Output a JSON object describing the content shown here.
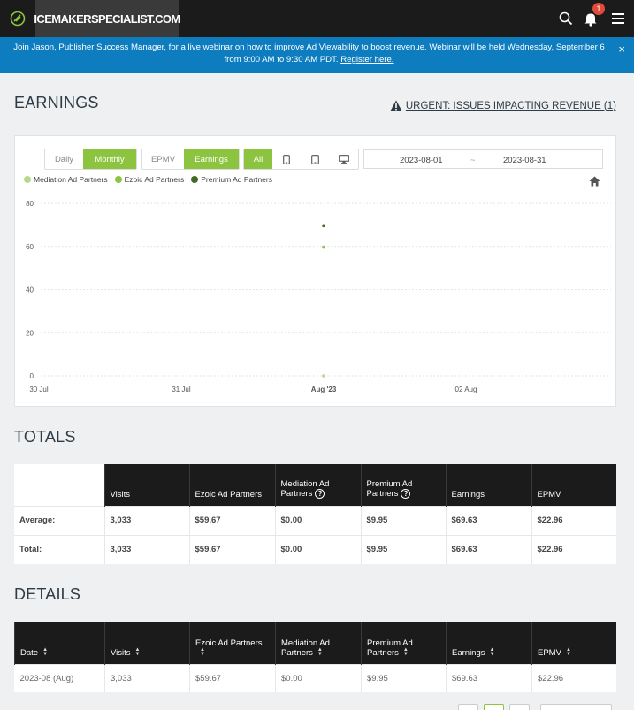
{
  "topbar": {
    "site_name": "ICEMAKERSPECIALIST.COM",
    "notification_count": "1",
    "icons": [
      "ezoic-logo-icon",
      "search-icon",
      "bell-icon",
      "menu-icon"
    ]
  },
  "banner": {
    "text": "Join Jason, Publisher Success Manager, for a live webinar on how to improve Ad Viewability to boost revenue. Webinar will be held Wednesday, September 6 from 9:00 AM to 9:30 AM PDT.",
    "link": "Register here.",
    "close": "×"
  },
  "earnings": {
    "title": "EARNINGS",
    "urgent_label": "URGENT: ISSUES IMPACTING REVENUE (1)"
  },
  "controls": {
    "period": [
      "Daily",
      "Monthly"
    ],
    "period_active": "Monthly",
    "metric": [
      "EPMV",
      "Earnings"
    ],
    "metric_active": "Earnings",
    "device_all": "All",
    "device_icons": [
      "tablet-icon",
      "mobile-icon",
      "desktop-icon"
    ],
    "date_start": "2023-08-01",
    "date_sep": "~",
    "date_end": "2023-08-31"
  },
  "chart_data": {
    "type": "scatter",
    "series": [
      {
        "name": "Mediation Ad Partners",
        "color": "#b5d88a",
        "points": [
          [
            "2023-08-01",
            0
          ]
        ]
      },
      {
        "name": "Ezoic Ad Partners",
        "color": "#8cc43f",
        "points": [
          [
            "2023-08-01",
            59.67
          ]
        ]
      },
      {
        "name": "Premium Ad Partners",
        "color": "#3f6b25",
        "points": [
          [
            "2023-08-01",
            69.63
          ]
        ]
      }
    ],
    "x_ticks": [
      "30 Jul",
      "31 Jul",
      "Aug '23",
      "02 Aug"
    ],
    "y_ticks": [
      0,
      20,
      40,
      60,
      80
    ],
    "ylim": [
      0,
      80
    ],
    "grid": true,
    "legend": "top-left"
  },
  "totals": {
    "title": "TOTALS",
    "headers": [
      "",
      "Visits",
      "Ezoic Ad Partners",
      "Mediation Ad Partners",
      "Premium Ad Partners",
      "Earnings",
      "EPMV"
    ],
    "rows": [
      [
        "Average:",
        "3,033",
        "$59.67",
        "$0.00",
        "$9.95",
        "$69.63",
        "$22.96"
      ],
      [
        "Total:",
        "3,033",
        "$59.67",
        "$0.00",
        "$9.95",
        "$69.63",
        "$22.96"
      ]
    ]
  },
  "details": {
    "title": "DETAILS",
    "headers": [
      "Date",
      "Visits",
      "Ezoic Ad Partners",
      "Mediation Ad Partners",
      "Premium Ad Partners",
      "Earnings",
      "EPMV"
    ],
    "rows": [
      [
        "2023-08 (Aug)",
        "3,033",
        "$59.67",
        "$0.00",
        "$9.95",
        "$69.63",
        "$22.96"
      ]
    ]
  }
}
